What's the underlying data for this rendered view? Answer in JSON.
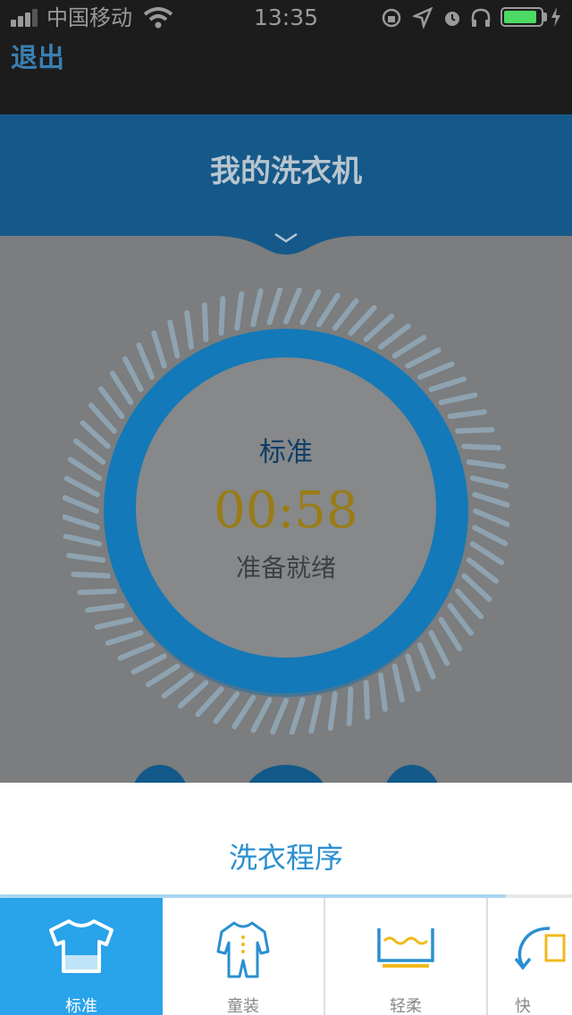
{
  "status_bar": {
    "carrier": "中国移动",
    "time": "13:35"
  },
  "nav": {
    "exit_label": "退出"
  },
  "header": {
    "title": "我的洗衣机"
  },
  "dial": {
    "mode": "标准",
    "timer": "00:58",
    "status": "准备就绪"
  },
  "sheet": {
    "title": "洗衣程序",
    "programs": [
      {
        "label": "标准",
        "icon": "t-shirt-icon",
        "active": true
      },
      {
        "label": "童装",
        "icon": "baby-onesie-icon",
        "active": false
      },
      {
        "label": "轻柔",
        "icon": "gentle-basin-icon",
        "active": false
      },
      {
        "label": "快",
        "icon": "quick-cycle-icon",
        "active": false
      }
    ]
  },
  "colors": {
    "accent": "#29a3ea",
    "header": "#15598a",
    "timer": "#9a7c13",
    "battery": "#4cd964"
  }
}
